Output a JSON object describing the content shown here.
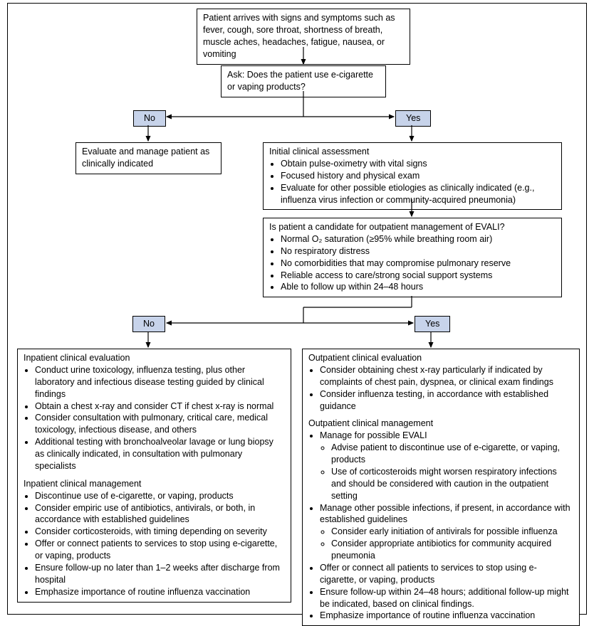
{
  "flow": {
    "start": "Patient arrives with signs and symptoms such as fever, cough, sore throat, shortness of breath, muscle aches, headaches, fatigue, nausea, or vomiting",
    "ask": "Ask: Does the patient use e-cigarette or vaping products?",
    "dec1_no": "No",
    "dec1_yes": "Yes",
    "no_path": "Evaluate and manage patient as clinically indicated",
    "initial": {
      "heading": "Initial clinical assessment",
      "b1": "Obtain pulse-oximetry with vital signs",
      "b2": "Focused history and physical exam",
      "b3": "Evaluate for other possible etiologies as clinically indicated (e.g., influenza virus infection or community-acquired pneumonia)"
    },
    "outpatient_candidate": {
      "heading": "Is patient a candidate for outpatient management of EVALI?",
      "b1": "Normal O₂ saturation (≥95% while breathing room air)",
      "b2": "No respiratory distress",
      "b3": "No comorbidities that may compromise pulmonary reserve",
      "b4": "Reliable access to care/strong social support systems",
      "b5": "Able to follow up within 24–48 hours"
    },
    "dec2_no": "No",
    "dec2_yes": "Yes",
    "inpatient": {
      "eval_heading": "Inpatient clinical evaluation",
      "e1": "Conduct urine toxicology, influenza testing, plus other laboratory and infectious disease testing guided by clinical findings",
      "e2": "Obtain a chest x-ray and consider CT if chest x-ray is normal",
      "e3": "Consider consultation with pulmonary, critical care, medical toxicology, infectious disease, and others",
      "e4": "Additional testing with bronchoalveolar lavage or lung biopsy as clinically indicated, in consultation with pulmonary specialists",
      "mgmt_heading": "Inpatient clinical management",
      "m1": "Discontinue use of e-cigarette, or vaping, products",
      "m2": "Consider empiric use of antibiotics, antivirals, or both, in accordance with established guidelines",
      "m3": "Consider corticosteroids, with timing depending on severity",
      "m4": "Offer or connect patients to services to stop using e-cigarette, or vaping, products",
      "m5": "Ensure follow-up no later than 1–2 weeks after discharge from hospital",
      "m6": "Emphasize importance of routine influenza vaccination"
    },
    "outpatient": {
      "eval_heading": "Outpatient clinical evaluation",
      "e1": "Consider obtaining chest x-ray particularly if indicated by complaints of chest pain, dyspnea, or clinical exam findings",
      "e2": "Consider influenza testing, in accordance with established guidance",
      "mgmt_heading": "Outpatient clinical management",
      "m1": "Manage for possible EVALI",
      "m1a": "Advise patient to discontinue use of e-cigarette, or vaping, products",
      "m1b": "Use of corticosteroids might worsen respiratory infections and should be considered with caution in the outpatient setting",
      "m2": "Manage other possible infections, if present, in accordance with established guidelines",
      "m2a": "Consider early initiation of antivirals for possible influenza",
      "m2b": "Consider appropriate antibiotics for community acquired pneumonia",
      "m3": "Offer or connect all patients to services to stop using e-cigarette, or vaping, products",
      "m4": "Ensure follow-up within 24–48 hours; additional follow-up might be indicated, based on clinical findings.",
      "m5": "Emphasize importance of routine influenza vaccination"
    }
  }
}
